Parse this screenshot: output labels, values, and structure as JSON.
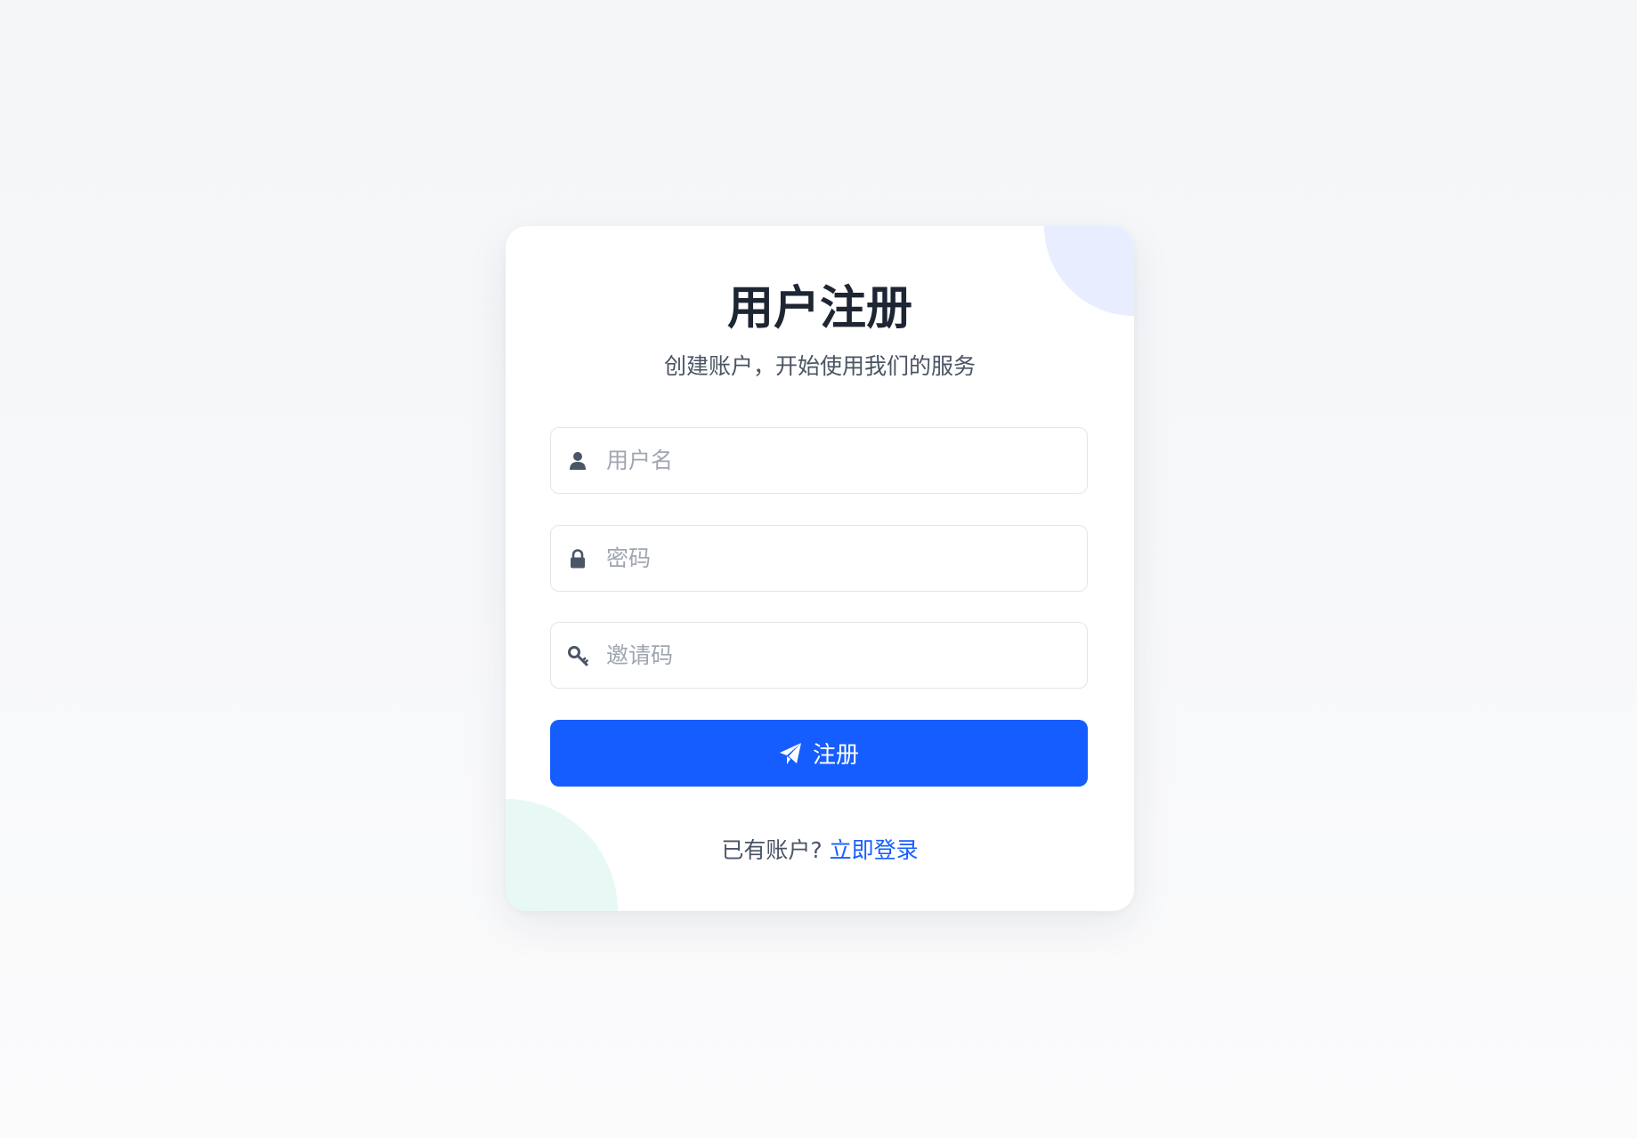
{
  "register": {
    "title": "用户注册",
    "subtitle": "创建账户，开始使用我们的服务"
  },
  "fields": {
    "username": {
      "placeholder": "用户名",
      "value": "",
      "icon": "user-icon"
    },
    "password": {
      "placeholder": "密码",
      "value": "",
      "icon": "lock-icon"
    },
    "invite_code": {
      "placeholder": "邀请码",
      "value": "",
      "icon": "key-icon"
    }
  },
  "submit": {
    "label": "注册",
    "icon": "paper-plane-icon"
  },
  "footer": {
    "prompt": "已有账户?",
    "login_link": "立即登录"
  },
  "colors": {
    "primary": "#165dff",
    "title_text": "#1e2533",
    "muted_text": "#4a5464",
    "placeholder_text": "#a0a6b0",
    "input_border": "#e2e5ea",
    "deco_top": "#e8eeff",
    "deco_bottom": "#e8f8f5",
    "icon": "#4a5566"
  }
}
